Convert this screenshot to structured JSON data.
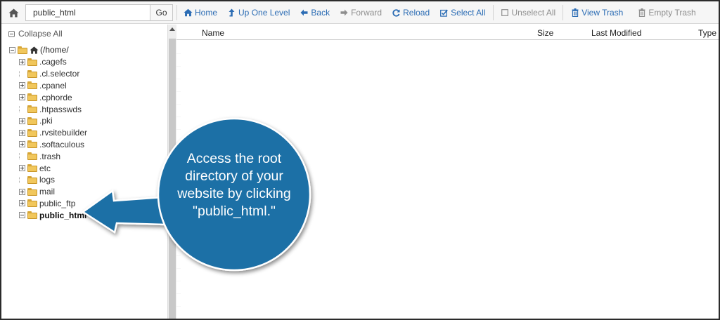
{
  "toolbar": {
    "path_value": "public_html",
    "go_label": "Go",
    "actions": [
      {
        "label": "Home",
        "icon": "home-icon",
        "disabled": false
      },
      {
        "label": "Up One Level",
        "icon": "level-up-icon",
        "disabled": false
      },
      {
        "label": "Back",
        "icon": "arrow-left-icon",
        "disabled": false
      },
      {
        "label": "Forward",
        "icon": "arrow-right-icon",
        "disabled": true
      },
      {
        "label": "Reload",
        "icon": "reload-icon",
        "disabled": false
      },
      {
        "label": "Select All",
        "icon": "checkbox-checked-icon",
        "disabled": false
      },
      {
        "label": "Unselect All",
        "icon": "checkbox-empty-icon",
        "disabled": true
      },
      {
        "label": "View Trash",
        "icon": "trash-icon",
        "disabled": false
      },
      {
        "label": "Empty Trash",
        "icon": "trash-icon",
        "disabled": true
      }
    ]
  },
  "tree": {
    "collapse_label": "Collapse All",
    "root_label": "(/home/",
    "items": [
      {
        "label": ".cagefs",
        "expandable": true,
        "selected": false
      },
      {
        "label": ".cl.selector",
        "expandable": false,
        "selected": false
      },
      {
        "label": ".cpanel",
        "expandable": true,
        "selected": false
      },
      {
        "label": ".cphorde",
        "expandable": true,
        "selected": false
      },
      {
        "label": ".htpasswds",
        "expandable": false,
        "selected": false
      },
      {
        "label": ".pki",
        "expandable": true,
        "selected": false
      },
      {
        "label": ".rvsitebuilder",
        "expandable": true,
        "selected": false
      },
      {
        "label": ".softaculous",
        "expandable": true,
        "selected": false
      },
      {
        "label": ".trash",
        "expandable": false,
        "selected": false
      },
      {
        "label": "etc",
        "expandable": true,
        "selected": false
      },
      {
        "label": "logs",
        "expandable": false,
        "selected": false
      },
      {
        "label": "mail",
        "expandable": true,
        "selected": false
      },
      {
        "label": "public_ftp",
        "expandable": true,
        "selected": false
      },
      {
        "label": "public_html",
        "expandable": false,
        "selected": true
      }
    ]
  },
  "list": {
    "columns": [
      "Name",
      "Size",
      "Last Modified",
      "Type"
    ]
  },
  "callout": {
    "text_lines": [
      "Access the root",
      "directory of your",
      "website by clicking",
      "\"public_html.\""
    ],
    "color": "#1f6fa6"
  },
  "colors": {
    "link": "#2b6cb4",
    "disabled": "#8e8e8e",
    "folder": "#f1c75c"
  }
}
